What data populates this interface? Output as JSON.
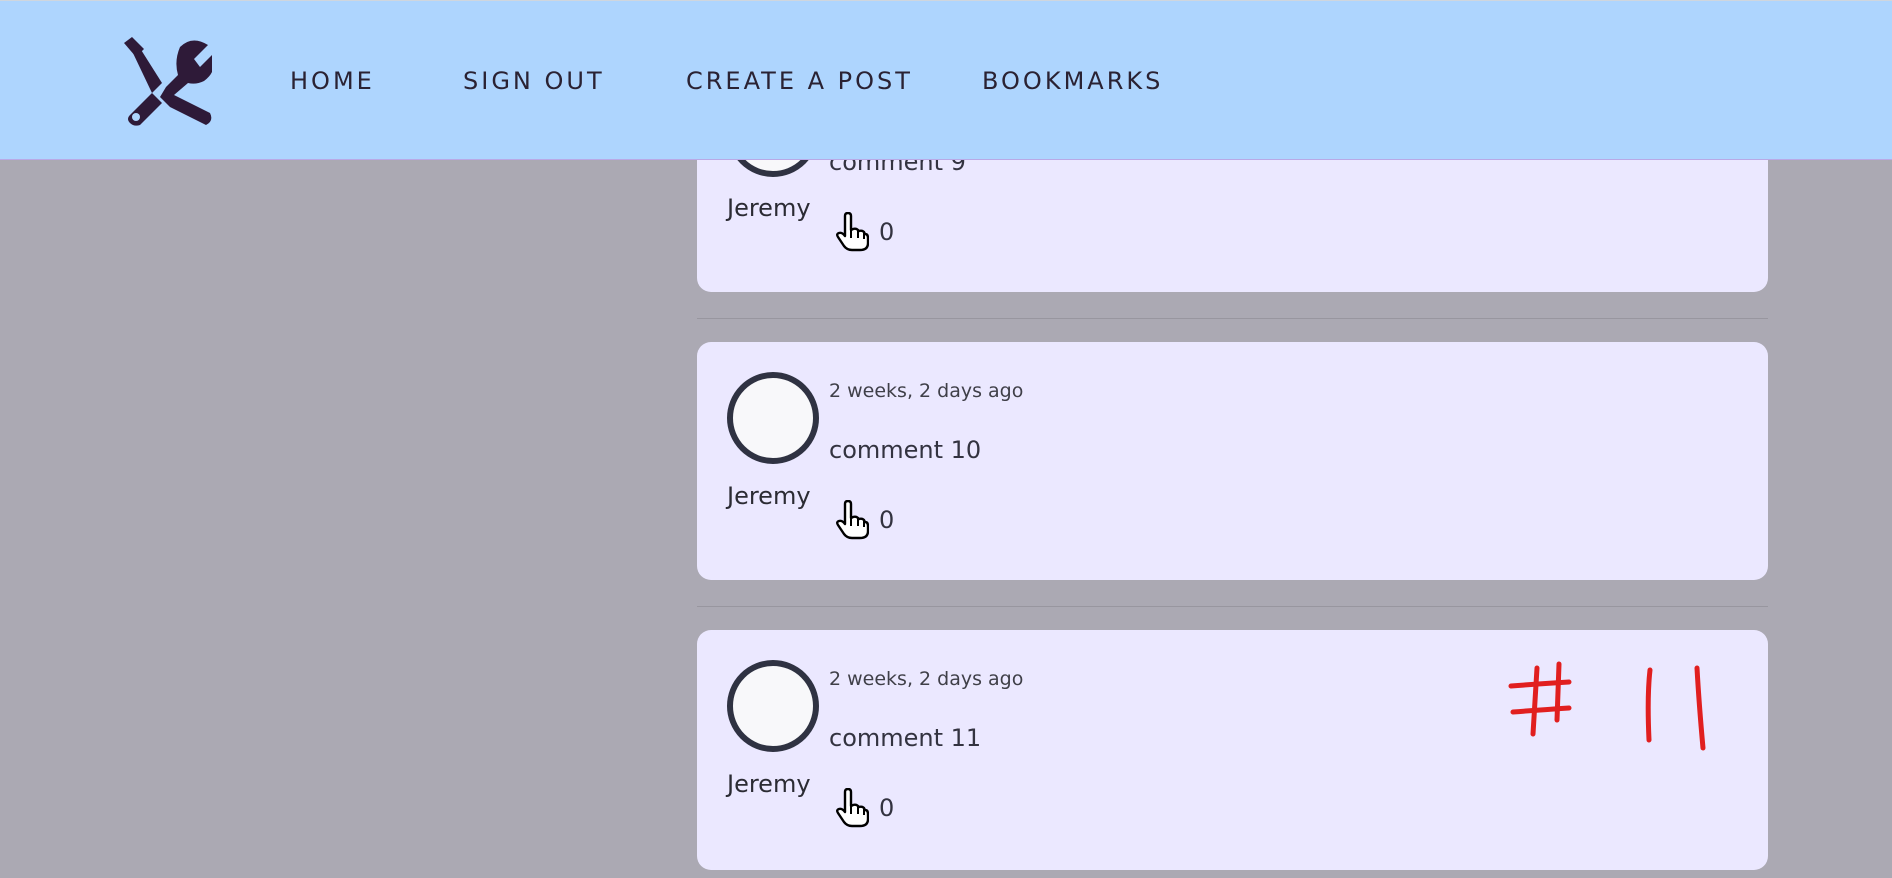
{
  "nav": {
    "logo_icon": "tools-icon",
    "links": [
      "HOME",
      "SIGN OUT",
      "CREATE A POST",
      "BOOKMARKS"
    ]
  },
  "comments": [
    {
      "author": "Jeremy",
      "time": "",
      "text": "comment 9",
      "likes": "0"
    },
    {
      "author": "Jeremy",
      "time": "2 weeks, 2 days ago",
      "text": "comment 10",
      "likes": "0"
    },
    {
      "author": "Jeremy",
      "time": "2 weeks, 2 days ago",
      "text": "comment 11",
      "likes": "0"
    }
  ],
  "annotation": {
    "text": "# 11",
    "color": "#e11f1f"
  },
  "colors": {
    "nav_bg": "#aed5fe",
    "card_bg": "#ebe8ff",
    "page_bg": "#aba9b3"
  }
}
